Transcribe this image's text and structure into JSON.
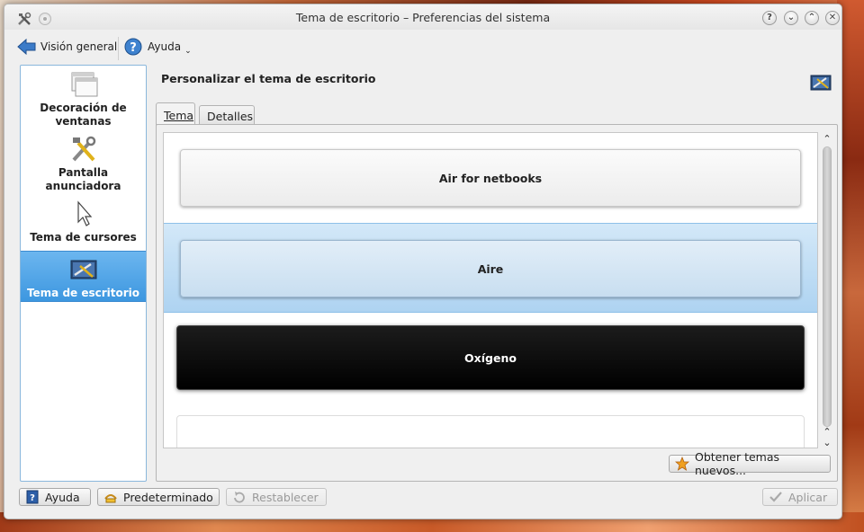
{
  "window": {
    "title": "Tema de escritorio – Preferencias del sistema",
    "buttons": {
      "help": "?",
      "minimize": "⌄",
      "maximize": "⌃",
      "close": "✕"
    }
  },
  "toolbar": {
    "overview_label": "Visión general",
    "help_label": "Ayuda"
  },
  "sidebar": {
    "items": [
      {
        "label": "Decoración de ventanas",
        "icon": "window-decoration-icon"
      },
      {
        "label": "Pantalla anunciadora",
        "icon": "tools-icon"
      },
      {
        "label": "Tema de cursores",
        "icon": "cursor-icon"
      },
      {
        "label": "Tema de escritorio",
        "icon": "desktop-theme-icon",
        "selected": true
      }
    ]
  },
  "main": {
    "heading": "Personalizar el tema de escritorio",
    "tabs": [
      {
        "label": "Tema",
        "active": true
      },
      {
        "label": "Detalles",
        "active": false
      }
    ],
    "themes": [
      {
        "name": "Air for netbooks",
        "selected": false
      },
      {
        "name": "Aire",
        "selected": true
      },
      {
        "name": "Oxígeno",
        "selected": false
      }
    ],
    "get_new_label": "Obtener temas nuevos..."
  },
  "footer": {
    "help_label": "Ayuda",
    "default_label": "Predeterminado",
    "reset_label": "Restablecer",
    "apply_label": "Aplicar"
  },
  "colors": {
    "selection": "#3d97e0",
    "list_selection": "#aed3f1"
  }
}
